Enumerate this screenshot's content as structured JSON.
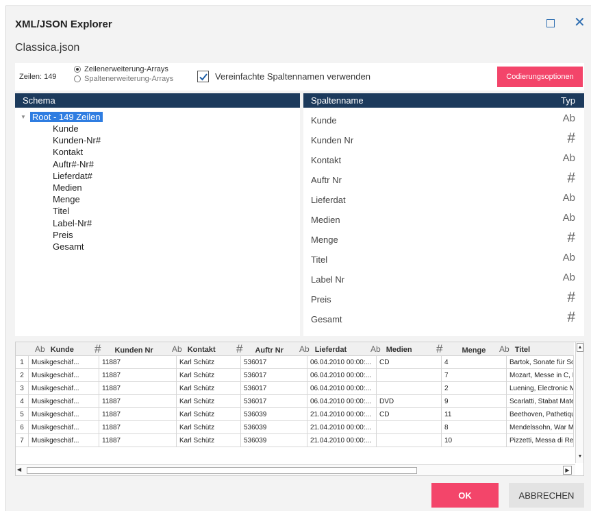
{
  "dialog": {
    "title": "XML/JSON Explorer",
    "filename": "Classica.json"
  },
  "options": {
    "rows_label": "Zeilen: 149",
    "radio_rows": "Zeilenerweiterung-Arrays",
    "radio_columns": "Spaltenerweiterung-Arrays",
    "radio_selected": "Zeilenerweiterung-Arrays",
    "simplified_names_label": "Vereinfachte Spaltennamen verwenden",
    "simplified_names_checked": true,
    "encoding_button": "Codierungsoptionen"
  },
  "schema": {
    "header": "Schema",
    "root_label": "Root - 149 Zeilen",
    "children": [
      "Kunde",
      "Kunden-Nr#",
      "Kontakt",
      "Auftr#-Nr#",
      "Lieferdat#",
      "Medien",
      "Menge",
      "Titel",
      "Label-Nr#",
      "Preis",
      "Gesamt"
    ]
  },
  "columns": {
    "header_name": "Spaltenname",
    "header_type": "Typ",
    "items": [
      {
        "name": "Kunde",
        "type": "Ab"
      },
      {
        "name": "Kunden Nr",
        "type": "#"
      },
      {
        "name": "Kontakt",
        "type": "Ab"
      },
      {
        "name": "Auftr Nr",
        "type": "#"
      },
      {
        "name": "Lieferdat",
        "type": "Ab"
      },
      {
        "name": "Medien",
        "type": "Ab"
      },
      {
        "name": "Menge",
        "type": "#"
      },
      {
        "name": "Titel",
        "type": "Ab"
      },
      {
        "name": "Label Nr",
        "type": "Ab"
      },
      {
        "name": "Preis",
        "type": "#"
      },
      {
        "name": "Gesamt",
        "type": "#"
      }
    ]
  },
  "grid": {
    "headers": [
      {
        "type": "Ab",
        "label": "Kunde"
      },
      {
        "type": "#",
        "label": "Kunden Nr"
      },
      {
        "type": "Ab",
        "label": "Kontakt"
      },
      {
        "type": "#",
        "label": "Auftr Nr"
      },
      {
        "type": "Ab",
        "label": "Lieferdat"
      },
      {
        "type": "Ab",
        "label": "Medien"
      },
      {
        "type": "#",
        "label": "Menge"
      },
      {
        "type": "Ab",
        "label": "Titel"
      }
    ],
    "rows": [
      [
        "1",
        "Musikgeschäf...",
        "11887",
        "Karl Schütz",
        "536017",
        "06.04.2010 00:00:...",
        "CD",
        "4",
        "Bartok, Sonate für So..."
      ],
      [
        "2",
        "Musikgeschäf...",
        "11887",
        "Karl Schütz",
        "536017",
        "06.04.2010 00:00:...",
        "",
        "7",
        "Mozart, Messe in C, K..."
      ],
      [
        "3",
        "Musikgeschäf...",
        "11887",
        "Karl Schütz",
        "536017",
        "06.04.2010 00:00:...",
        "",
        "2",
        "Luening, Electronic M..."
      ],
      [
        "4",
        "Musikgeschäf...",
        "11887",
        "Karl Schütz",
        "536017",
        "06.04.2010 00:00:...",
        "DVD",
        "9",
        "Scarlatti, Stabat Mater"
      ],
      [
        "5",
        "Musikgeschäf...",
        "11887",
        "Karl Schütz",
        "536039",
        "21.04.2010 00:00:...",
        "CD",
        "11",
        "Beethoven, Pathetiqu..."
      ],
      [
        "6",
        "Musikgeschäf...",
        "11887",
        "Karl Schütz",
        "536039",
        "21.04.2010 00:00:...",
        "",
        "8",
        "Mendelssohn, War M..."
      ],
      [
        "7",
        "Musikgeschäf...",
        "11887",
        "Karl Schütz",
        "536039",
        "21.04.2010 00:00:...",
        "",
        "10",
        "Pizzetti, Messa di Re..."
      ]
    ]
  },
  "footer": {
    "ok": "OK",
    "cancel": "ABBRECHEN"
  },
  "colors": {
    "accent": "#f3456a",
    "panel_header": "#1c3a5c",
    "selection": "#2f7de1",
    "window_icons": "#2b6cb0"
  }
}
